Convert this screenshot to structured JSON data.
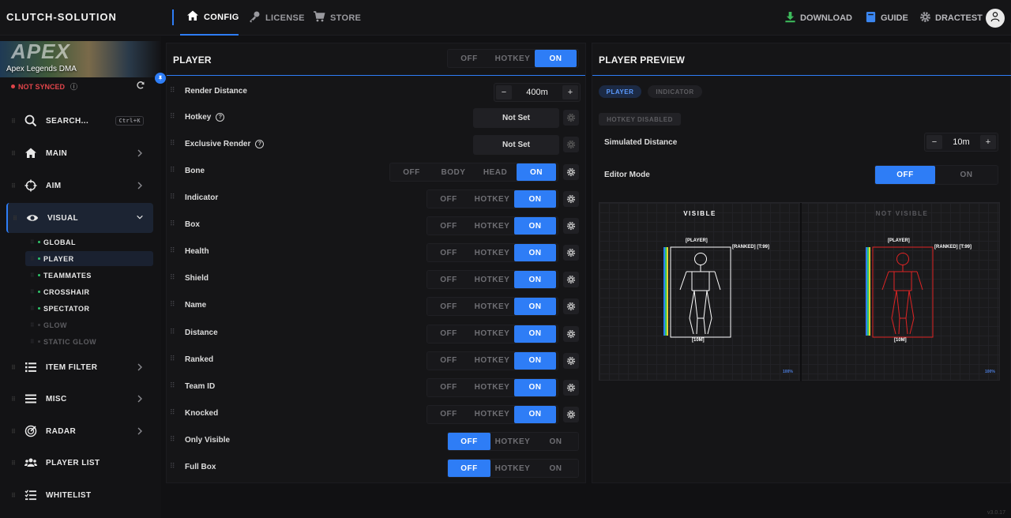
{
  "app": {
    "brand": "CLUTCH-SOLUTION",
    "version": "v3.0.17"
  },
  "topnav": {
    "tabs": [
      {
        "label": "CONFIG",
        "icon": "home-icon",
        "active": true
      },
      {
        "label": "LICENSE",
        "icon": "key-icon",
        "active": false
      },
      {
        "label": "STORE",
        "icon": "cart-icon",
        "active": false
      }
    ],
    "right": [
      {
        "label": "DOWNLOAD",
        "icon": "download-icon",
        "color": "#3dbb5c"
      },
      {
        "label": "GUIDE",
        "icon": "book-icon",
        "color": "#3b86f0"
      },
      {
        "label": "DRACTEST",
        "icon": "gear-icon",
        "color": "#9a9a9f"
      }
    ]
  },
  "sidebar": {
    "banner_logo": "APEX",
    "banner_name": "Apex Legends DMA",
    "sync_status": "NOT SYNCED",
    "search": {
      "label": "SEARCH...",
      "shortcut": "Ctrl+K"
    },
    "items": [
      {
        "label": "MAIN",
        "icon": "home-icon"
      },
      {
        "label": "AIM",
        "icon": "crosshair-icon"
      },
      {
        "label": "VISUAL",
        "icon": "eye-icon",
        "expanded": true
      },
      {
        "label": "ITEM FILTER",
        "icon": "list-icon"
      },
      {
        "label": "MISC",
        "icon": "menu-icon"
      },
      {
        "label": "RADAR",
        "icon": "radar-icon"
      },
      {
        "label": "PLAYER LIST",
        "icon": "users-icon"
      },
      {
        "label": "WHITELIST",
        "icon": "checklist-icon"
      }
    ],
    "visual_sub": [
      {
        "label": "GLOBAL",
        "enabled": true
      },
      {
        "label": "PLAYER",
        "enabled": true,
        "active": true
      },
      {
        "label": "TEAMMATES",
        "enabled": true
      },
      {
        "label": "CROSSHAIR",
        "enabled": true
      },
      {
        "label": "SPECTATOR",
        "enabled": true
      },
      {
        "label": "GLOW",
        "enabled": false
      },
      {
        "label": "STATIC GLOW",
        "enabled": false
      }
    ]
  },
  "player_panel": {
    "title": "PLAYER",
    "master_toggle": {
      "options": [
        "OFF",
        "HOTKEY",
        "ON"
      ],
      "selected": "ON"
    },
    "render_distance": {
      "label": "Render Distance",
      "value": "400m",
      "minus": "−",
      "plus": "+"
    },
    "hotkey": {
      "label": "Hotkey",
      "value": "Not Set"
    },
    "exclusive_render": {
      "label": "Exclusive Render",
      "value": "Not Set"
    },
    "bone": {
      "label": "Bone",
      "options": [
        "OFF",
        "BODY",
        "HEAD",
        "ON"
      ],
      "selected": "ON"
    },
    "toggles": [
      {
        "label": "Indicator",
        "selected": "ON"
      },
      {
        "label": "Box",
        "selected": "ON"
      },
      {
        "label": "Health",
        "selected": "ON"
      },
      {
        "label": "Shield",
        "selected": "ON"
      },
      {
        "label": "Name",
        "selected": "ON"
      },
      {
        "label": "Distance",
        "selected": "ON"
      },
      {
        "label": "Ranked",
        "selected": "ON"
      },
      {
        "label": "Team ID",
        "selected": "ON"
      },
      {
        "label": "Knocked",
        "selected": "ON"
      }
    ],
    "plain_toggles": [
      {
        "label": "Only Visible",
        "selected": "OFF"
      },
      {
        "label": "Full Box",
        "selected": "OFF"
      }
    ],
    "toggle_options": [
      "OFF",
      "HOTKEY",
      "ON"
    ]
  },
  "preview_panel": {
    "title": "PLAYER PREVIEW",
    "tabs": [
      {
        "label": "PLAYER",
        "active": true
      },
      {
        "label": "INDICATOR",
        "active": false
      }
    ],
    "hotkey_badge": "HOTKEY DISABLED",
    "simulated_distance": {
      "label": "Simulated Distance",
      "value": "10m",
      "minus": "−",
      "plus": "+"
    },
    "editor_mode": {
      "label": "Editor Mode",
      "options": [
        "OFF",
        "ON"
      ],
      "selected": "OFF"
    },
    "visible": {
      "title": "VISIBLE",
      "player_tag": "[PLAYER]",
      "ranked_tag": "[RANKED] [T:99]",
      "distance_tag": "[10M]",
      "zoom": "100%",
      "color": "#ffffff"
    },
    "not_visible": {
      "title": "NOT VISIBLE",
      "player_tag": "[PLAYER]",
      "ranked_tag": "[RANKED] [T:99]",
      "distance_tag": "[10M]",
      "zoom": "100%",
      "color": "#e02424"
    }
  }
}
